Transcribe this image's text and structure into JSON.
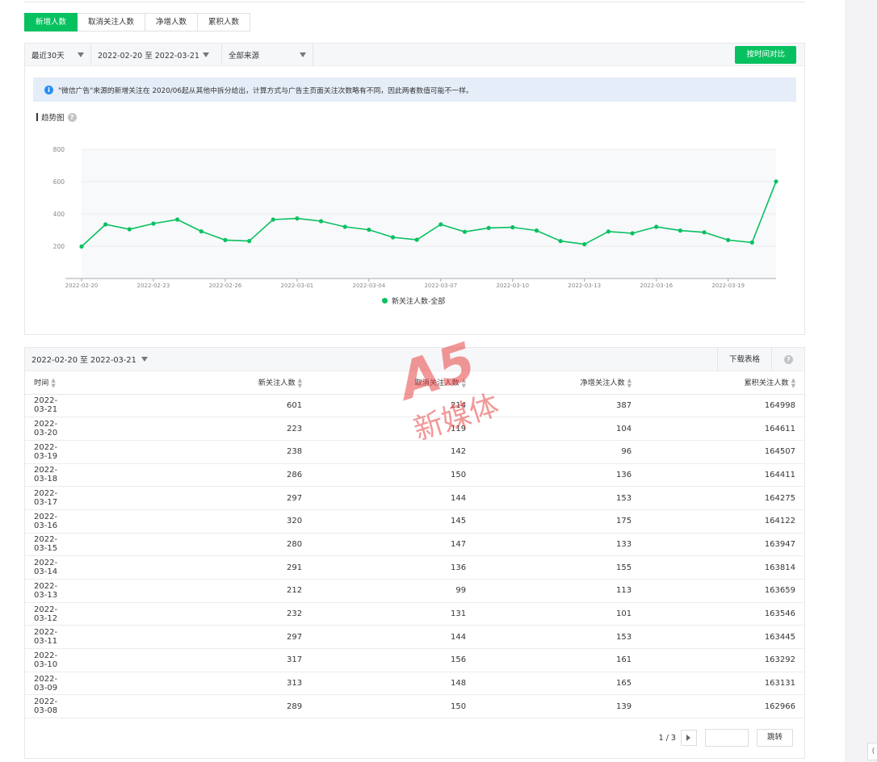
{
  "tabs": [
    {
      "label": "新增人数",
      "active": true
    },
    {
      "label": "取消关注人数",
      "active": false
    },
    {
      "label": "净增人数",
      "active": false
    },
    {
      "label": "累积人数",
      "active": false
    }
  ],
  "filters": {
    "period": "最近30天",
    "date_range": "2022-02-20 至 2022-03-21",
    "source": "全部来源",
    "compare_button": "按时间对比"
  },
  "notice": "\"微信广告\"来源的新增关注在 2020/06起从其他中拆分给出，计算方式与广告主页面关注次数略有不同，因此两者数值可能不一样。",
  "info_icon": "i",
  "trend_title": "趋势图",
  "help_icon": "?",
  "chart_data": {
    "type": "line",
    "x": [
      "2022-02-20",
      "2022-02-21",
      "2022-02-22",
      "2022-02-23",
      "2022-02-24",
      "2022-02-25",
      "2022-02-26",
      "2022-02-27",
      "2022-02-28",
      "2022-03-01",
      "2022-03-02",
      "2022-03-03",
      "2022-03-04",
      "2022-03-05",
      "2022-03-06",
      "2022-03-07",
      "2022-03-08",
      "2022-03-09",
      "2022-03-10",
      "2022-03-11",
      "2022-03-12",
      "2022-03-13",
      "2022-03-14",
      "2022-03-15",
      "2022-03-16",
      "2022-03-17",
      "2022-03-18",
      "2022-03-19",
      "2022-03-20",
      "2022-03-21"
    ],
    "xticks": [
      "2022-02-20",
      "2022-02-23",
      "2022-02-26",
      "2022-03-01",
      "2022-03-04",
      "2022-03-07",
      "2022-03-10",
      "2022-03-13",
      "2022-03-16",
      "2022-03-19"
    ],
    "series": [
      {
        "name": "新关注人数-全部",
        "values": [
          198,
          335,
          305,
          340,
          365,
          292,
          238,
          232,
          365,
          372,
          355,
          320,
          302,
          255,
          240,
          335,
          289,
          313,
          317,
          297,
          232,
          212,
          291,
          280,
          320,
          297,
          286,
          238,
          223,
          601
        ]
      }
    ],
    "yticks": [
      200,
      400,
      600,
      800
    ],
    "ylim": [
      0,
      800
    ],
    "color": "#07c160"
  },
  "table": {
    "range": "2022-02-20 至 2022-03-21",
    "download": "下载表格",
    "columns": [
      "时间",
      "新关注人数",
      "取消关注人数",
      "净增关注人数",
      "累积关注人数"
    ],
    "rows": [
      [
        "2022-03-21",
        "601",
        "214",
        "387",
        "164998"
      ],
      [
        "2022-03-20",
        "223",
        "119",
        "104",
        "164611"
      ],
      [
        "2022-03-19",
        "238",
        "142",
        "96",
        "164507"
      ],
      [
        "2022-03-18",
        "286",
        "150",
        "136",
        "164411"
      ],
      [
        "2022-03-17",
        "297",
        "144",
        "153",
        "164275"
      ],
      [
        "2022-03-16",
        "320",
        "145",
        "175",
        "164122"
      ],
      [
        "2022-03-15",
        "280",
        "147",
        "133",
        "163947"
      ],
      [
        "2022-03-14",
        "291",
        "136",
        "155",
        "163814"
      ],
      [
        "2022-03-13",
        "212",
        "99",
        "113",
        "163659"
      ],
      [
        "2022-03-12",
        "232",
        "131",
        "101",
        "163546"
      ],
      [
        "2022-03-11",
        "297",
        "144",
        "153",
        "163445"
      ],
      [
        "2022-03-10",
        "317",
        "156",
        "161",
        "163292"
      ],
      [
        "2022-03-09",
        "313",
        "148",
        "165",
        "163131"
      ],
      [
        "2022-03-08",
        "289",
        "150",
        "139",
        "162966"
      ]
    ]
  },
  "pager": {
    "text": "1 / 3",
    "go": "跳转"
  },
  "watermark": {
    "logo": "A5",
    "text": "新媒体"
  },
  "side_button": "("
}
